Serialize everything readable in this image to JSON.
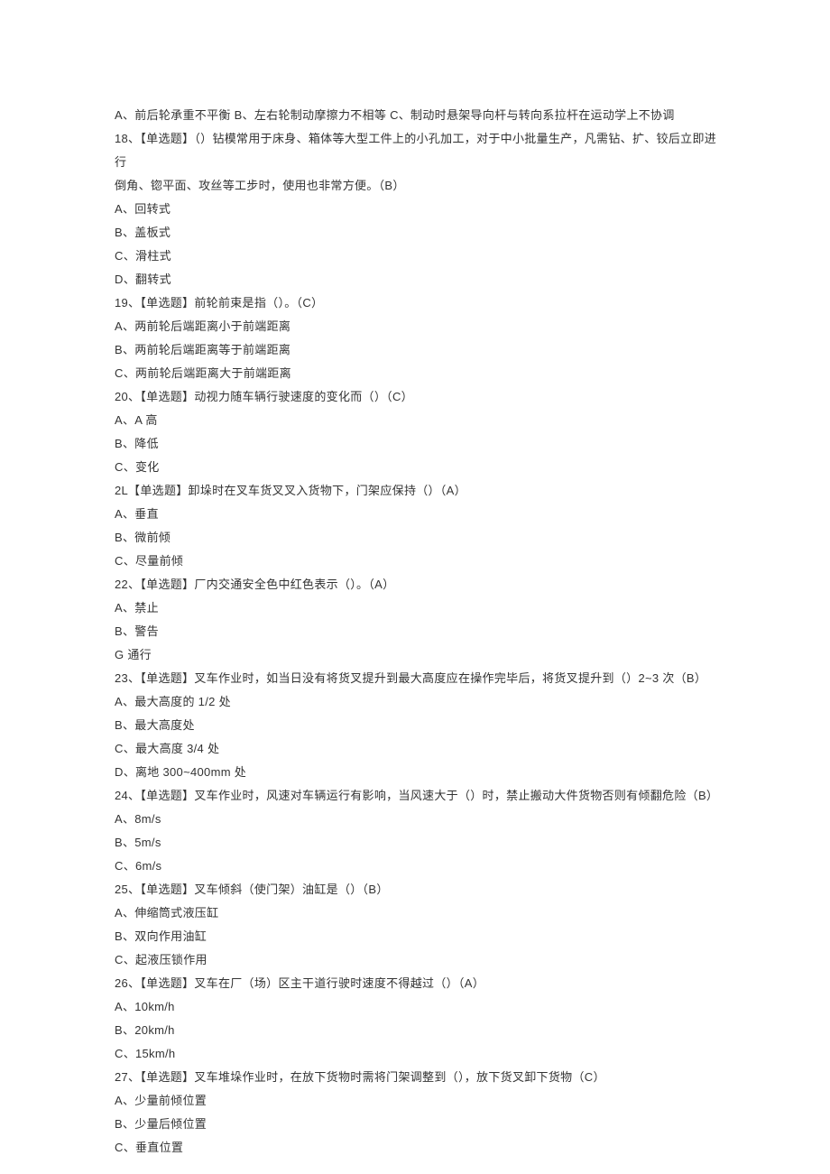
{
  "q17_opts": "A、前后轮承重不平衡 B、左右轮制动摩擦力不相等 C、制动时悬架导向杆与转向系拉杆在运动学上不协调",
  "q18_stem1": "18、【单选题】（）钻模常用于床身、箱体等大型工件上的小孔加工，对于中小批量生产，凡需钻、扩、铰后立即进行",
  "q18_stem2": "倒角、锪平面、攻丝等工步时，使用也非常方便。（B）",
  "q18_a": "A、回转式",
  "q18_b": "B、盖板式",
  "q18_c": "C、滑柱式",
  "q18_d": "D、翻转式",
  "q19_stem": "19、【单选题】前轮前束是指（）。（C）",
  "q19_a": "A、两前轮后端距离小于前端距离",
  "q19_b": "B、两前轮后端距离等于前端距离",
  "q19_c": "C、两前轮后端距离大于前端距离",
  "q20_stem": "20、【单选题】动视力随车辆行驶速度的变化而（）（C）",
  "q20_a": "A、A 高",
  "q20_b": "B、降低",
  "q20_c": "C、变化",
  "q21_stem": "2L【单选题】卸垛时在叉车货叉叉入货物下，门架应保持（）（A）",
  "q21_a": "A、垂直",
  "q21_b": "B、微前倾",
  "q21_c": "C、尽量前倾",
  "q22_stem": "22、【单选题】厂内交通安全色中红色表示（）。（A）",
  "q22_a": "A、禁止",
  "q22_b": "B、警告",
  "q22_c": "G 通行",
  "q23_stem": "23、【单选题】叉车作业时，如当日没有将货叉提升到最大高度应在操作完毕后，将货叉提升到（）2~3 次（B）",
  "q23_a": "A、最大高度的 1/2 处",
  "q23_b": "B、最大高度处",
  "q23_c": "C、最大高度 3/4 处",
  "q23_d": "D、离地 300~400mm 处",
  "q24_stem": "24、【单选题】叉车作业时，风速对车辆运行有影响，当风速大于（）时，禁止搬动大件货物否则有倾翻危险（B）",
  "q24_a": "A、8m/s",
  "q24_b": "B、5m/s",
  "q24_c": "C、6m/s",
  "q25_stem": "25、【单选题】叉车倾斜（使门架）油缸是（）（B）",
  "q25_a": "A、伸缩筒式液压缸",
  "q25_b": "B、双向作用油缸",
  "q25_c": "C、起液压锁作用",
  "q26_stem": "26、【单选题】叉车在厂（场）区主干道行驶时速度不得越过（）（A）",
  "q26_a": "A、10km/h",
  "q26_b": "B、20km/h",
  "q26_c": "C、15km/h",
  "q27_stem": "27、【单选题】叉车堆垛作业时，在放下货物时需将门架调整到（），放下货叉卸下货物（C）",
  "q27_a": "A、少量前倾位置",
  "q27_b": "B、少量后倾位置",
  "q27_c": "C、垂直位置"
}
